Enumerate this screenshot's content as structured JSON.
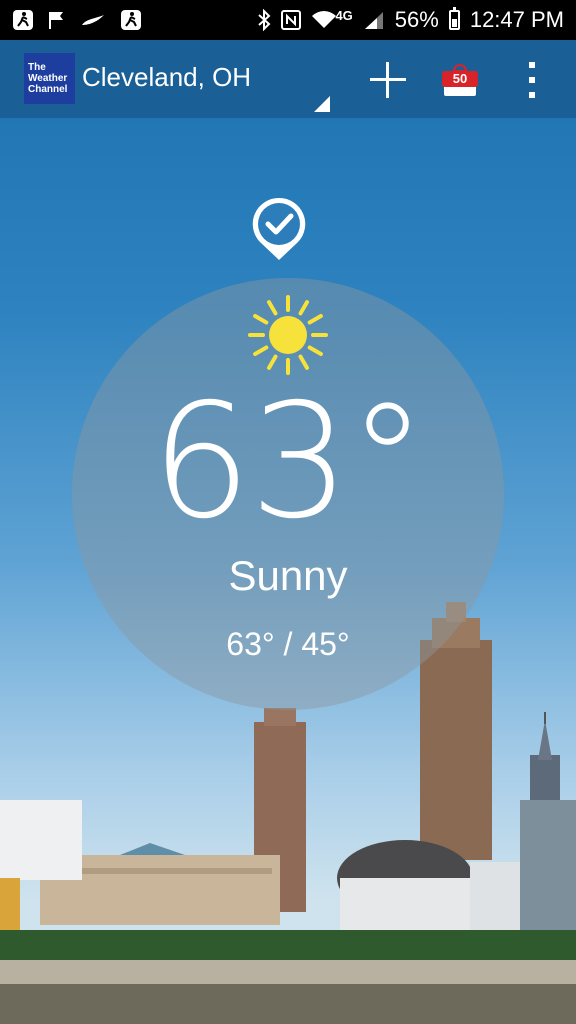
{
  "status_bar": {
    "battery": "56%",
    "battery_level": 0.56,
    "time": "12:47 PM",
    "network": "4G",
    "icons": [
      "walk-icon",
      "flag-icon",
      "swoosh-icon",
      "walk-icon",
      "bluetooth-icon",
      "nfc-icon",
      "wifi-icon",
      "signal-icon",
      "battery-icon"
    ]
  },
  "app_bar": {
    "logo_lines": [
      "The",
      "Weather",
      "Channel"
    ],
    "location": "Cleveland, OH",
    "gift_badge": "50",
    "icons": [
      "add-icon",
      "gift-icon",
      "overflow-menu-icon"
    ]
  },
  "current": {
    "temperature": "63°",
    "condition": "Sunny",
    "hi_lo": "63° / 45°",
    "icon": "sun-icon",
    "sun_color": "#f6e23a"
  },
  "colors": {
    "app_bar": "#1a5f96",
    "logo": "#1d3e9e",
    "badge": "#d8232a"
  }
}
